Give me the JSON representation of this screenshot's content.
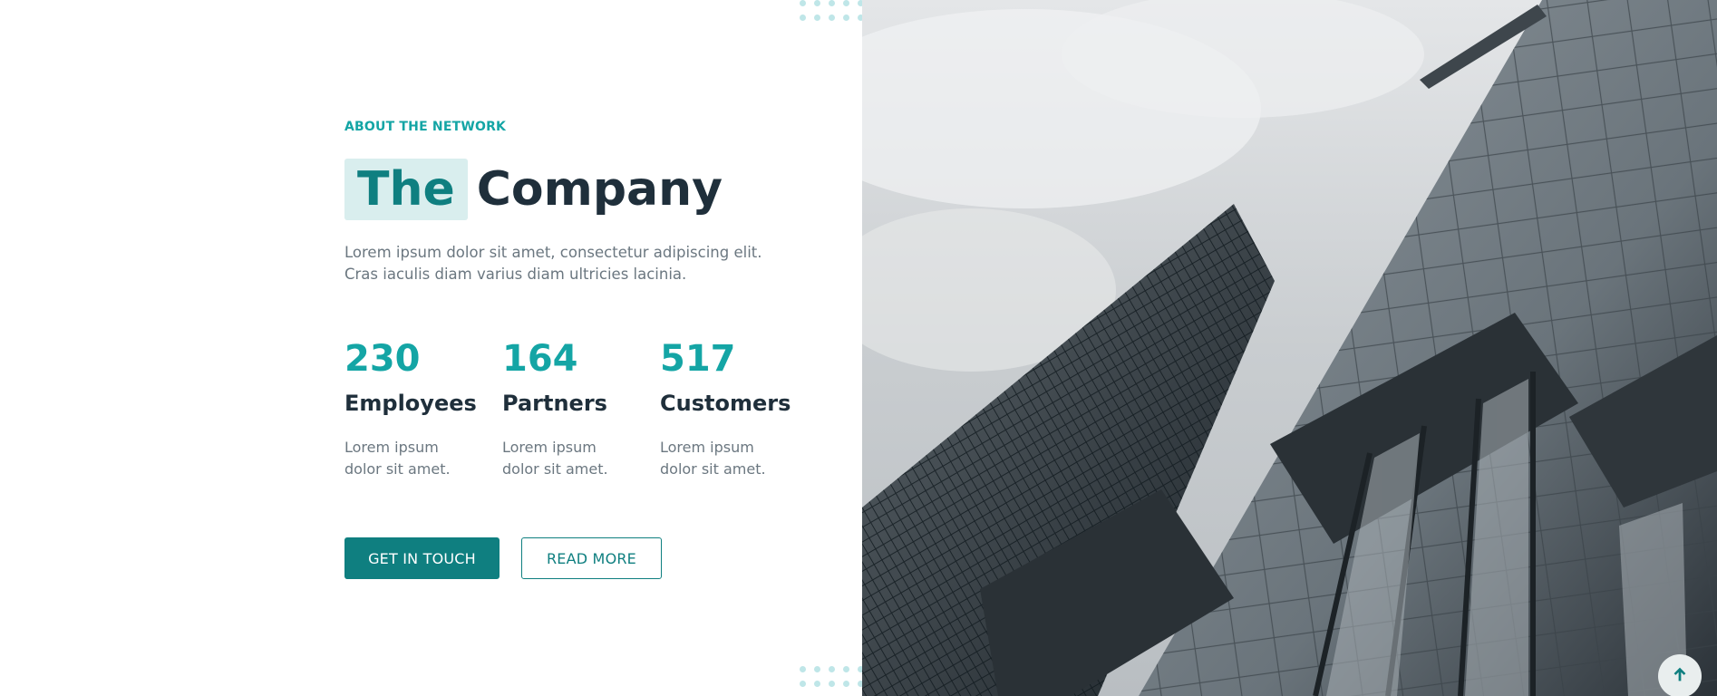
{
  "about": {
    "eyebrow": "ABOUT THE NETWORK",
    "title_highlight": "The",
    "title_rest": "Company",
    "lead": "Lorem ipsum dolor sit amet, consectetur adipiscing elit. Cras iaculis diam varius diam ultricies lacinia."
  },
  "stats": [
    {
      "number": "230",
      "label": "Employees",
      "desc": "Lorem ipsum dolor sit amet."
    },
    {
      "number": "164",
      "label": "Partners",
      "desc": "Lorem ipsum dolor sit amet."
    },
    {
      "number": "517",
      "label": "Customers",
      "desc": "Lorem ipsum dolor sit amet."
    }
  ],
  "buttons": {
    "primary": "GET IN TOUCH",
    "secondary": "READ MORE"
  },
  "icons": {
    "scroll_top": "arrow-up-icon"
  },
  "colors": {
    "accent": "#14a5a5",
    "accent_dark": "#0f7f80",
    "heading": "#1f2f3b",
    "body_text": "#6b7780",
    "highlight_bg": "#d9eeee",
    "dots": "#bfe6e8"
  }
}
